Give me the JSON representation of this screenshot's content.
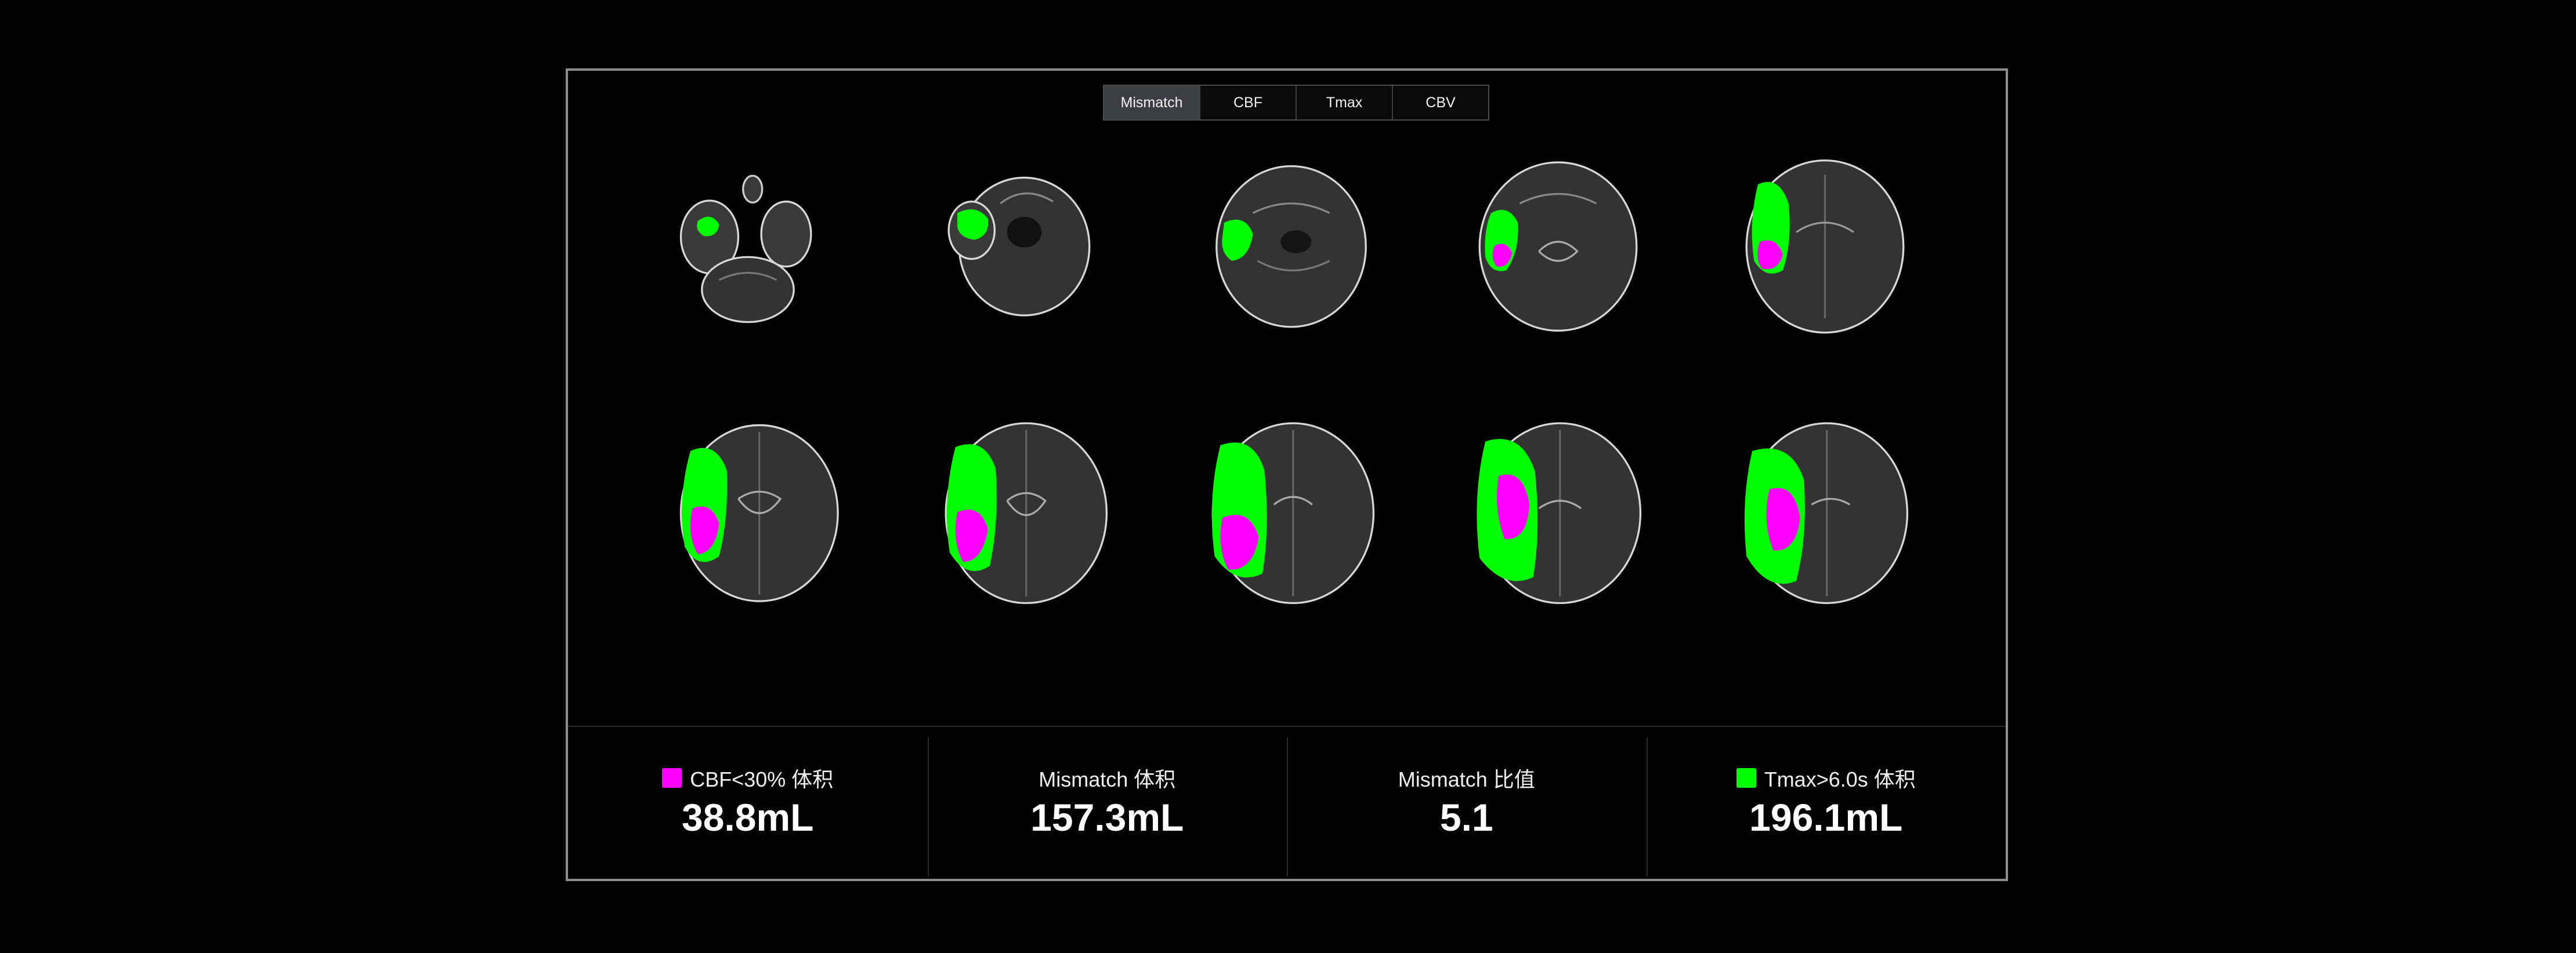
{
  "tabs": [
    {
      "label": "Mismatch",
      "active": true
    },
    {
      "label": "CBF",
      "active": false
    },
    {
      "label": "Tmax",
      "active": false
    },
    {
      "label": "CBV",
      "active": false
    }
  ],
  "colors": {
    "cbf_core": "#ff00ff",
    "tmax_penumbra": "#00ff00",
    "tab_active_bg": "#3b3f42"
  },
  "stats": [
    {
      "label": "CBF<30% 体积",
      "value": "38.8mL",
      "swatch": "#ff00ff"
    },
    {
      "label": "Mismatch 体积",
      "value": "157.3mL",
      "swatch": null
    },
    {
      "label": "Mismatch 比值",
      "value": "5.1",
      "swatch": null
    },
    {
      "label": "Tmax>6.0s 体积",
      "value": "196.1mL",
      "swatch": "#00ff00"
    }
  ],
  "slice_count": 10
}
